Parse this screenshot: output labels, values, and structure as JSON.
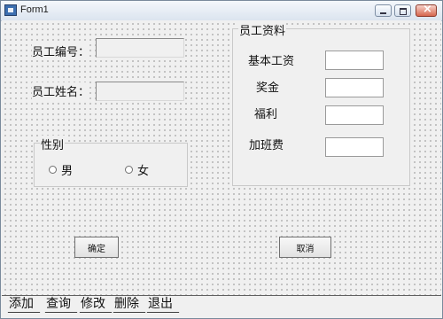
{
  "window": {
    "title": "Form1",
    "icon": "form-app-icon"
  },
  "employee": {
    "id_label": "员工编号：",
    "id_value": "",
    "name_label": "员工姓名：",
    "name_value": ""
  },
  "gender": {
    "caption": "性别",
    "options": [
      "男",
      "女"
    ],
    "selected": null
  },
  "details": {
    "caption": "员工资料",
    "salary_label": "基本工资",
    "salary_value": "",
    "bonus_label": "奖金",
    "bonus_value": "",
    "welfare_label": "福利",
    "welfare_value": "",
    "overtime_label": "加班费",
    "overtime_value": ""
  },
  "buttons": {
    "ok": "确定",
    "cancel": "取消"
  },
  "tabs": [
    "添加",
    "查询",
    "修改",
    "删除",
    "退出"
  ]
}
